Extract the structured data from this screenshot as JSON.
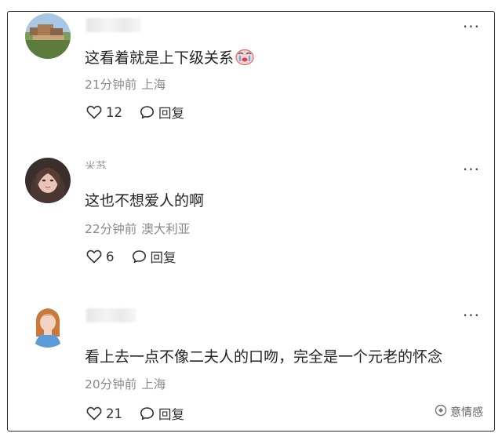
{
  "comments": [
    {
      "text": "这看着就是上下级关系",
      "emoji_icon": "crying-face-emoji",
      "time": "21分钟前",
      "location": "上海",
      "likes": "12",
      "reply_label": "回复"
    },
    {
      "username": "米苏",
      "text": "这也不想爱人的啊",
      "time": "22分钟前",
      "location": "澳大利亚",
      "likes": "6",
      "reply_label": "回复"
    },
    {
      "text": "看上去一点不像二夫人的口吻，完全是一个元老的怀念",
      "time": "20分钟前",
      "location": "上海",
      "likes": "21",
      "reply_label": "回复"
    }
  ],
  "more_label": "···",
  "watermark": "意情感",
  "icons": {
    "like": "heart-outline-icon",
    "reply": "speech-bubble-icon",
    "more": "more-dots-icon"
  },
  "colors": {
    "text": "#222222",
    "meta": "#8a8a8a",
    "border": "#2b2b2b"
  }
}
